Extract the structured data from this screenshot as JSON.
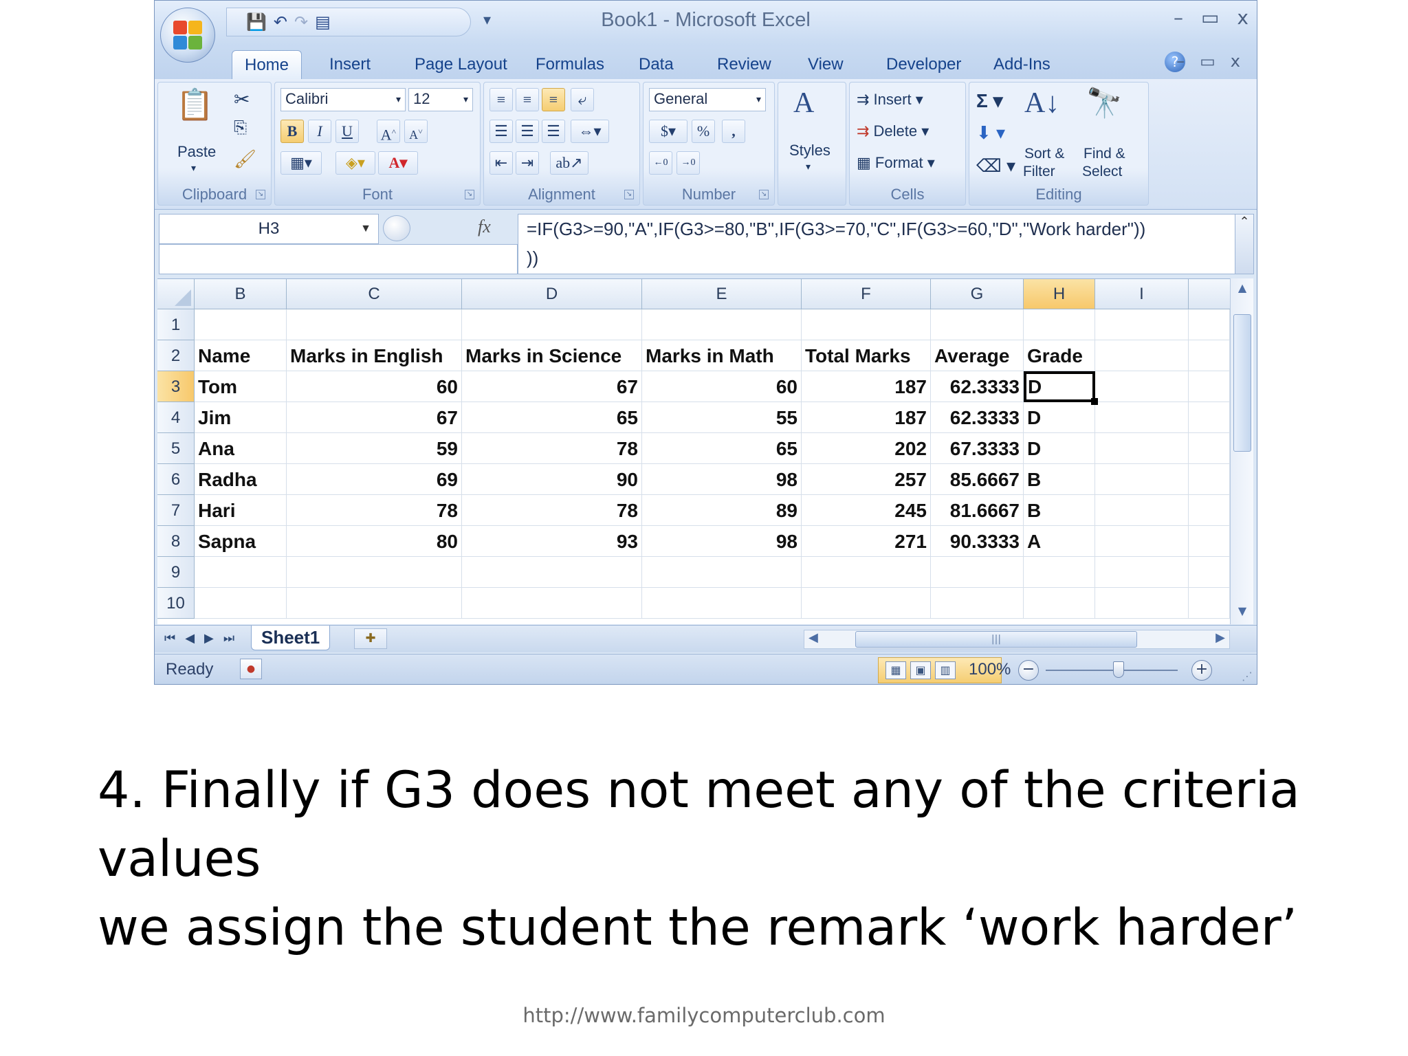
{
  "window": {
    "title": "Book1 - Microsoft Excel",
    "controls": [
      "–",
      "▭",
      "x"
    ]
  },
  "tabs": [
    "Home",
    "Insert",
    "Page Layout",
    "Formulas",
    "Data",
    "Review",
    "View",
    "Developer",
    "Add-Ins"
  ],
  "active_tab": "Home",
  "ribbon": {
    "clipboard": {
      "label": "Clipboard",
      "paste": "Paste"
    },
    "font": {
      "label": "Font",
      "name": "Calibri",
      "size": "12",
      "bold": "B",
      "italic": "I",
      "underline": "U"
    },
    "alignment": {
      "label": "Alignment"
    },
    "number": {
      "label": "Number",
      "format": "General",
      "currency": "$",
      "percent": "%",
      "comma": ","
    },
    "styles": {
      "label": "Styles"
    },
    "cells": {
      "label": "Cells",
      "insert": "Insert",
      "delete": "Delete",
      "format": "Format"
    },
    "editing": {
      "label": "Editing",
      "sort_line1": "Sort &",
      "sort_line2": "Filter",
      "find_line1": "Find &",
      "find_line2": "Select"
    }
  },
  "formula_bar": {
    "name_box": "H3",
    "fx": "fx",
    "formula_line1": "=IF(G3>=90,\"A\",IF(G3>=80,\"B\",IF(G3>=70,\"C\",IF(G3>=60,\"D\",\"Work harder\"))",
    "formula_line2": "))"
  },
  "sheet": {
    "columns": [
      "B",
      "C",
      "D",
      "E",
      "F",
      "G",
      "H",
      "I"
    ],
    "selected_column": "H",
    "row_numbers": [
      "1",
      "2",
      "3",
      "4",
      "5",
      "6",
      "7",
      "8",
      "9",
      "10"
    ],
    "selected_row": "3",
    "headers": [
      "Name",
      "Marks in English",
      "Marks in Science",
      "Marks in Math",
      "Total Marks",
      "Average",
      "Grade"
    ],
    "rows": [
      [
        "Tom",
        "60",
        "67",
        "60",
        "187",
        "62.3333",
        "D"
      ],
      [
        "Jim",
        "67",
        "65",
        "55",
        "187",
        "62.3333",
        "D"
      ],
      [
        "Ana",
        "59",
        "78",
        "65",
        "202",
        "67.3333",
        "D"
      ],
      [
        "Radha",
        "69",
        "90",
        "98",
        "257",
        "85.6667",
        "B"
      ],
      [
        "Hari",
        "78",
        "78",
        "89",
        "245",
        "81.6667",
        "B"
      ],
      [
        "Sapna",
        "80",
        "93",
        "98",
        "271",
        "90.3333",
        "A"
      ]
    ],
    "active_cell": "H3"
  },
  "sheet_tabs": {
    "active": "Sheet1"
  },
  "status": {
    "ready": "Ready",
    "zoom": "100%"
  },
  "slide": {
    "caption_line1": "4. Finally if G3 does not meet any of the criteria values",
    "caption_line2": "we assign the student the remark ‘work harder’",
    "footer_url": "http://www.familycomputerclub.com"
  }
}
